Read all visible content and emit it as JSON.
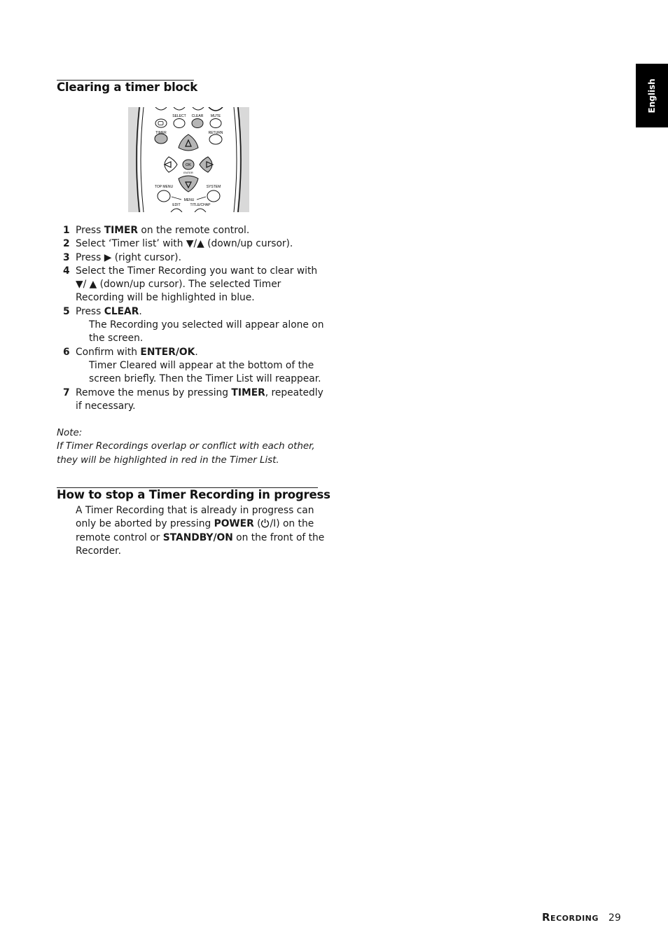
{
  "language_tab": "English",
  "section1": {
    "title": "Clearing a timer block",
    "figure": {
      "labels": [
        "SELECT",
        "CLEAR",
        "MUTE",
        "TIMER",
        "RETURN",
        "OK",
        "ENTER",
        "TOP MENU",
        "SYSTEM",
        "MENU",
        "EDIT",
        "TITLE/CHAP"
      ]
    },
    "steps": [
      {
        "num": "1",
        "parts": [
          {
            "t": "Press ",
            "b": false
          },
          {
            "t": "TIMER",
            "b": true
          },
          {
            "t": " on the remote control.",
            "b": false
          }
        ]
      },
      {
        "num": "2",
        "parts": [
          {
            "t": "Select ‘Timer list’ with ▼/▲ (down/up cursor).",
            "b": false
          }
        ]
      },
      {
        "num": "3",
        "parts": [
          {
            "t": "Press ▶ (right cursor).",
            "b": false
          }
        ]
      },
      {
        "num": "4",
        "parts": [
          {
            "t": "Select the Timer Recording you want to clear with ▼/ ▲ (down/up cursor). The selected Timer Recording will be highlighted in blue.",
            "b": false
          }
        ]
      },
      {
        "num": "5",
        "parts": [
          {
            "t": "Press ",
            "b": false
          },
          {
            "t": "CLEAR",
            "b": true
          },
          {
            "t": ".",
            "b": false
          }
        ],
        "sub": "The Recording you selected will appear alone on the screen."
      },
      {
        "num": "6",
        "parts": [
          {
            "t": "Confirm with ",
            "b": false
          },
          {
            "t": "ENTER/OK",
            "b": true
          },
          {
            "t": ".",
            "b": false
          }
        ],
        "sub": "Timer Cleared will appear at the bottom of the screen briefly. Then the Timer List will reappear."
      },
      {
        "num": "7",
        "parts": [
          {
            "t": "Remove the menus by pressing ",
            "b": false
          },
          {
            "t": "TIMER",
            "b": true
          },
          {
            "t": ", repeatedly if necessary.",
            "b": false
          }
        ]
      }
    ],
    "note_label": "Note:",
    "note_text": "If Timer Recordings overlap or conflict with each other, they will be highlighted in red in the Timer List."
  },
  "section2": {
    "title": "How to stop a Timer Recording in progress",
    "p1": "A Timer Recording that is already in progress can only be aborted by pressing ",
    "power": "POWER",
    "p2": " (",
    "p3": "/I) on the remote control or ",
    "standby": "STANDBY/ON",
    "p4": " on the front of the Recorder."
  },
  "footer": {
    "section": "Recording",
    "page": "29"
  }
}
